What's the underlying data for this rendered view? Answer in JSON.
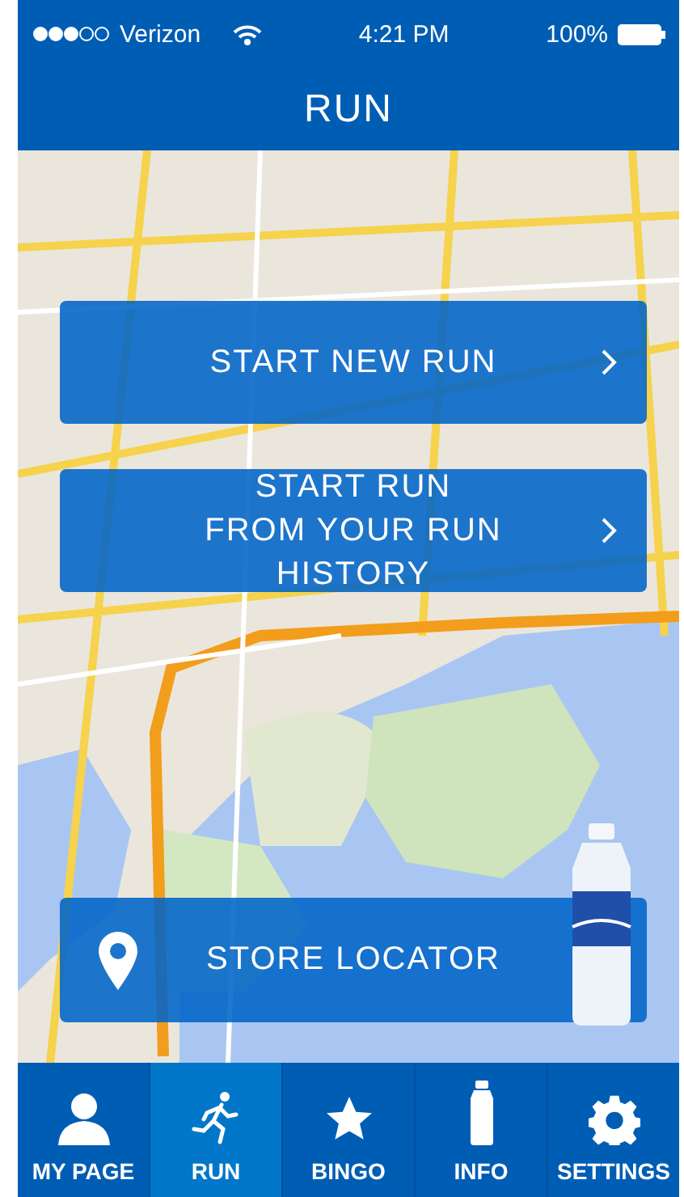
{
  "status_bar": {
    "carrier": "Verizon",
    "time": "4:21 PM",
    "battery": "100%"
  },
  "header": {
    "title": "RUN"
  },
  "actions": [
    {
      "kind": "chevron",
      "lines": [
        "START NEW RUN"
      ]
    },
    {
      "kind": "chevron",
      "lines": [
        "START RUN",
        "FROM YOUR RUN HISTORY"
      ]
    },
    {
      "kind": "locator",
      "lines": [
        "STORE LOCATOR"
      ]
    }
  ],
  "tabs": [
    {
      "label": "MY PAGE",
      "selected": false
    },
    {
      "label": "RUN",
      "selected": true
    },
    {
      "label": "BINGO",
      "selected": false
    },
    {
      "label": "INFO",
      "selected": false
    },
    {
      "label": "SETTINGS",
      "selected": false
    }
  ]
}
